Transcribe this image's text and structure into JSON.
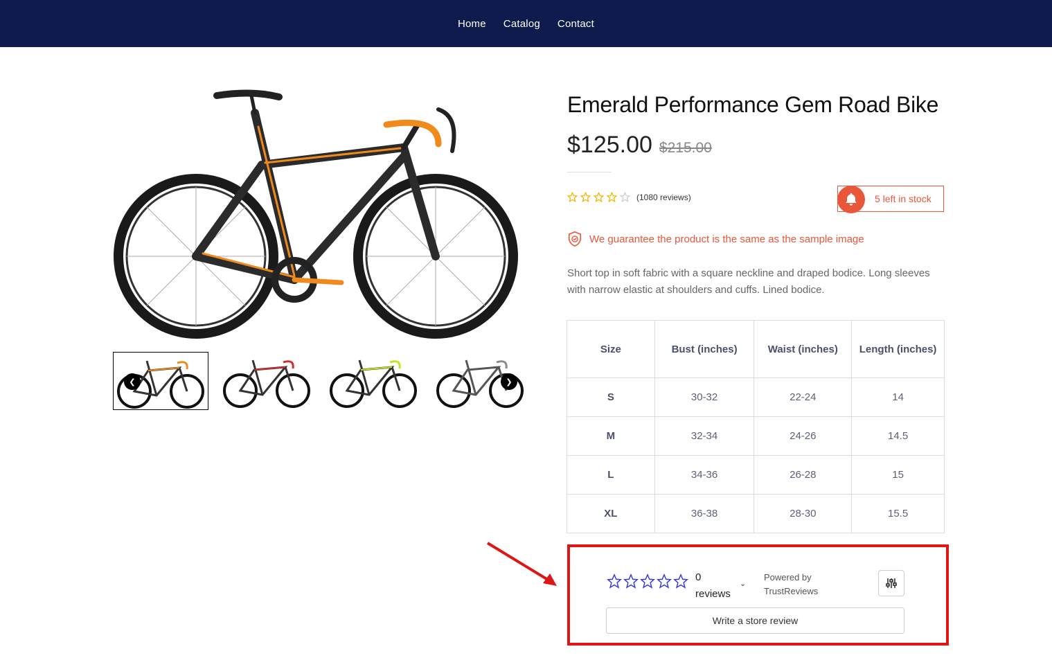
{
  "nav": {
    "items": [
      "Home",
      "Catalog",
      "Contact"
    ]
  },
  "product": {
    "title": "Emerald Performance Gem Road Bike",
    "price": "$125.00",
    "old_price": "$215.00",
    "rating_count": "(1080 reviews)",
    "rating_stars": 4,
    "stock": "5 left in stock",
    "guarantee": "We guarantee the product is the same as the sample image",
    "description": "Short top in soft fabric with a square neckline and draped bodice. Long sleeves with narrow elastic at shoulders and cuffs. Lined bodice."
  },
  "gallery": {
    "thumbnail_colors": [
      "#f08a1c",
      "#d62b2b",
      "#c8e31a",
      "#8a8a8a"
    ],
    "prev_icon": "chevron-left-icon",
    "next_icon": "chevron-right-icon"
  },
  "size_table": {
    "headers": [
      "Size",
      "Bust (inches)",
      "Waist (inches)",
      "Length (inches)"
    ],
    "rows": [
      [
        "S",
        "30-32",
        "22-24",
        "14"
      ],
      [
        "M",
        "32-34",
        "24-26",
        "14.5"
      ],
      [
        "L",
        "34-36",
        "26-28",
        "15"
      ],
      [
        "XL",
        "36-38",
        "28-30",
        "15.5"
      ]
    ]
  },
  "reviews_widget": {
    "count_number": "0",
    "count_label": "reviews",
    "powered_by": "Powered by",
    "brand": "TrustReviews",
    "write_button": "Write a store review",
    "star_color": "#3a3dcf"
  },
  "colors": {
    "nav_bg": "#0f1b4d",
    "accent": "#e8573a",
    "highlight_box": "#e01515"
  }
}
